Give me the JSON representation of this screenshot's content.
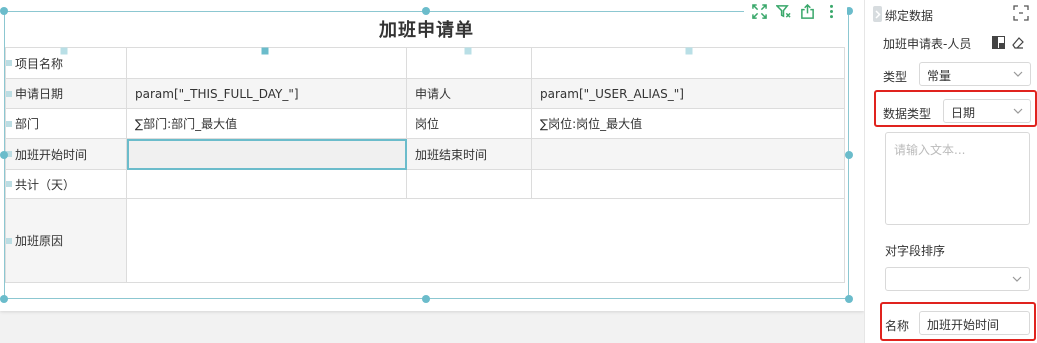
{
  "report": {
    "title": "加班申请单",
    "rows": [
      [
        "项目名称",
        "",
        "",
        ""
      ],
      [
        "申请日期",
        "param[\"_THIS_FULL_DAY_\"]",
        "申请人",
        "param[\"_USER_ALIAS_\"]"
      ],
      [
        "部门",
        "∑部门:部门_最大值",
        "岗位",
        "∑岗位:岗位_最大值"
      ],
      [
        "加班开始时间",
        "",
        "加班结束时间",
        ""
      ],
      [
        "共计（天）",
        "",
        "",
        ""
      ],
      [
        "加班原因",
        "",
        "",
        ""
      ]
    ]
  },
  "toolbar": {
    "icons": [
      "expand-icon",
      "filter-icon",
      "export-icon",
      "more-icon"
    ]
  },
  "panel": {
    "title": "绑定数据",
    "source_name": "加班申请表-人员",
    "type_label": "类型",
    "type_value": "常量",
    "data_type_label": "数据类型",
    "data_type_value": "日期",
    "text_placeholder": "请输入文本...",
    "sort_label": "对字段排序",
    "sort_value": "",
    "name_label": "名称",
    "name_value": "加班开始时间"
  },
  "colors": {
    "selection": "#6bbccb",
    "highlight": "#e0231e",
    "shade": "#f5f5f5"
  }
}
